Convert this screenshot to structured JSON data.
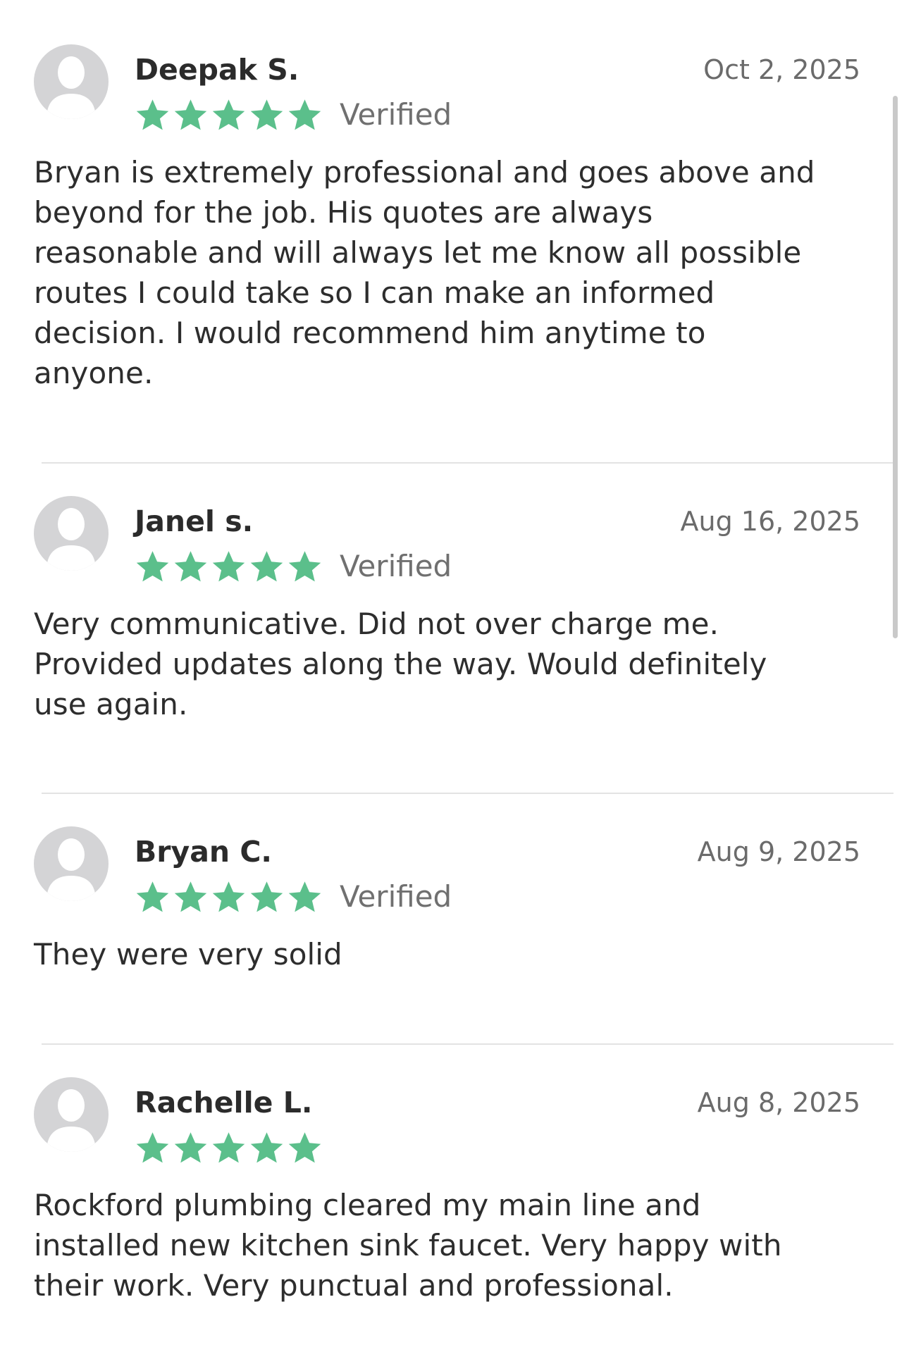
{
  "reviews": [
    {
      "name": "Deepak S.",
      "date": "Oct 2, 2025",
      "rating": 5,
      "verified_label": "Verified",
      "text": "Bryan is extremely professional and goes above and\nbeyond for the job. His quotes are always\nreasonable and will always let me know all possible\nroutes I could take so I can make an informed\ndecision. I would recommend him anytime to\nanyone."
    },
    {
      "name": "Janel s.",
      "date": "Aug 16, 2025",
      "rating": 5,
      "verified_label": "Verified",
      "text": "Very communicative. Did not over charge me.\nProvided updates along the way. Would definitely\nuse again."
    },
    {
      "name": "Bryan C.",
      "date": "Aug 9, 2025",
      "rating": 5,
      "verified_label": "Verified",
      "text": "They were very solid"
    },
    {
      "name": "Rachelle L.",
      "date": "Aug 8, 2025",
      "rating": 5,
      "text": "Rockford plumbing cleared my main line and\ninstalled new kitchen sink faucet. Very happy with\ntheir work. Very punctual and professional."
    }
  ],
  "colors": {
    "star": "#5bbf8b",
    "avatar_bg": "#d4d4d6",
    "avatar_fg": "#ffffff",
    "divider": "#e3e3e3",
    "scrollbar": "#c9c9c9"
  },
  "icons": {
    "avatar": "default-user-avatar-icon",
    "star": "star-filled-icon"
  }
}
